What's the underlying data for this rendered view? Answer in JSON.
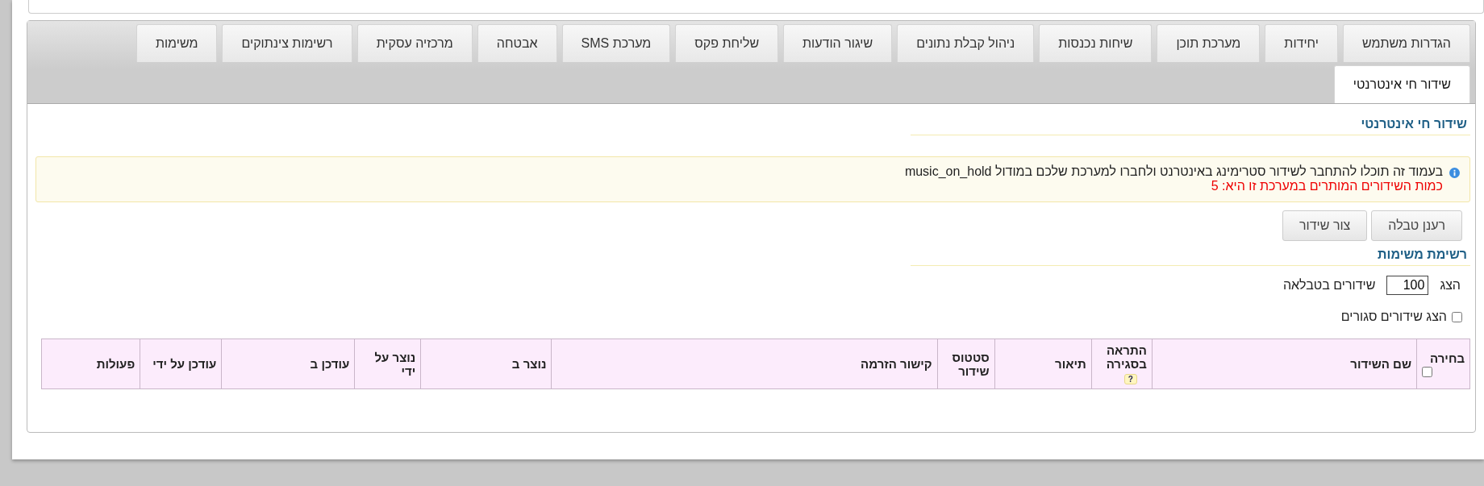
{
  "tabs": [
    {
      "label": "הגדרות משתמש",
      "selected": false
    },
    {
      "label": "יחידות",
      "selected": false
    },
    {
      "label": "מערכת תוכן",
      "selected": false
    },
    {
      "label": "שיחות נכנסות",
      "selected": false
    },
    {
      "label": "ניהול קבלת נתונים",
      "selected": false
    },
    {
      "label": "שיגור הודעות",
      "selected": false
    },
    {
      "label": "שליחת פקס",
      "selected": false
    },
    {
      "label": "מערכת SMS",
      "selected": false
    },
    {
      "label": "אבטחה",
      "selected": false
    },
    {
      "label": "מרכזיה עסקית",
      "selected": false
    },
    {
      "label": "רשימות צינתוקים",
      "selected": false
    },
    {
      "label": "משימות",
      "selected": false
    },
    {
      "label": "שידור חי אינטרנטי",
      "selected": true
    }
  ],
  "section_title": "שידור חי אינטרנטי",
  "alert": {
    "text": "בעמוד זה תוכלו להתחבר לשידור סטרימינג באינטרנט ולחברו למערכת שלכם במודול music_on_hold",
    "limit": "כמות השידורים המותרים במערכת זו היא: 5"
  },
  "buttons": [
    "רענן טבלה",
    "צור שידור"
  ],
  "list_title": "רשימת משימות",
  "page_size": {
    "before": "הצג",
    "value": "100",
    "after": "שידורים בטבלאה"
  },
  "show_closed": {
    "label": "הצג שידורים סגורים",
    "checked": false
  },
  "table": {
    "columns": [
      {
        "label": "בחירה",
        "kind": "checkbox",
        "checked": false
      },
      {
        "label": "שם השידור",
        "kind": "text"
      },
      {
        "label": "התראה בסגירה",
        "kind": "help",
        "help": "?"
      },
      {
        "label": "תיאור",
        "kind": "text"
      },
      {
        "label": "סטטוס שידור",
        "kind": "text"
      },
      {
        "label": "קישור הזרמה",
        "kind": "text"
      },
      {
        "label": "נוצר ב",
        "kind": "text"
      },
      {
        "label": "נוצר על ידי",
        "kind": "text"
      },
      {
        "label": "עודכן ב",
        "kind": "text"
      },
      {
        "label": "עודכן על ידי",
        "kind": "text"
      },
      {
        "label": "פעולות",
        "kind": "text"
      }
    ]
  }
}
